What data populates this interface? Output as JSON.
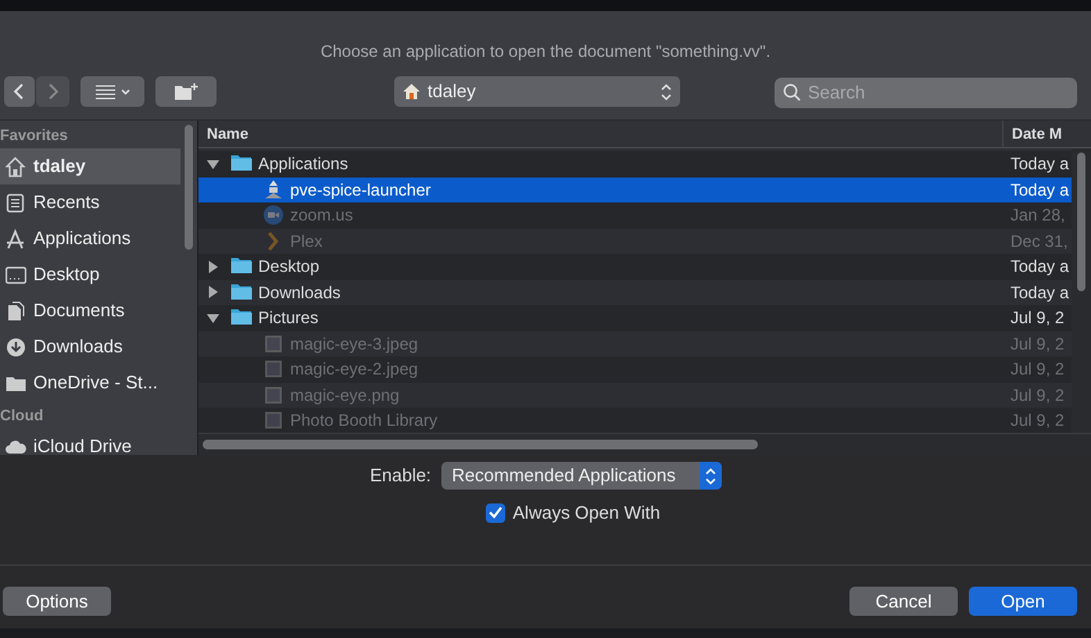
{
  "dialog": {
    "title": "Choose an application to open the document \"something.vv\"."
  },
  "toolbar": {
    "location": "tdaley",
    "search": {
      "placeholder": "Search"
    }
  },
  "sidebar": {
    "sections": [
      {
        "label": "Favorites",
        "items": [
          {
            "label": "tdaley",
            "kind": "home",
            "selected": true
          },
          {
            "label": "Recents",
            "kind": "recents",
            "selected": false
          },
          {
            "label": "Applications",
            "kind": "applications",
            "selected": false
          },
          {
            "label": "Desktop",
            "kind": "desktop",
            "selected": false
          },
          {
            "label": "Documents",
            "kind": "documents",
            "selected": false
          },
          {
            "label": "Downloads",
            "kind": "downloads",
            "selected": false
          },
          {
            "label": "OneDrive - St...",
            "kind": "folder",
            "selected": false
          }
        ]
      },
      {
        "label": "Cloud",
        "items": [
          {
            "label": "iCloud Drive",
            "kind": "cloud",
            "selected": false
          }
        ]
      }
    ]
  },
  "table": {
    "columns": [
      "Name",
      "Date M"
    ],
    "rows": [
      {
        "name": "Applications",
        "date": "Today a",
        "kind": "folder",
        "expanded": true,
        "enabled": true,
        "selected": false,
        "children": [
          {
            "name": "pve-spice-launcher",
            "date": "Today a",
            "kind": "app",
            "enabled": true,
            "selected": true
          },
          {
            "name": "zoom.us",
            "date": "Jan 28,",
            "kind": "video-app",
            "enabled": false,
            "selected": false
          },
          {
            "name": "Plex",
            "date": "Dec 31,",
            "kind": "chevron-app",
            "enabled": false,
            "selected": false
          }
        ]
      },
      {
        "name": "Desktop",
        "date": "Today a",
        "kind": "folder",
        "expanded": false,
        "enabled": true,
        "selected": false
      },
      {
        "name": "Downloads",
        "date": "Today a",
        "kind": "folder",
        "expanded": false,
        "enabled": true,
        "selected": false
      },
      {
        "name": "Pictures",
        "date": "Jul 9, 2",
        "kind": "folder",
        "expanded": true,
        "enabled": true,
        "selected": false,
        "children": [
          {
            "name": "magic-eye-3.jpeg",
            "date": "Jul 9, 2",
            "kind": "image",
            "enabled": false,
            "selected": false
          },
          {
            "name": "magic-eye-2.jpeg",
            "date": "Jul 9, 2",
            "kind": "image",
            "enabled": false,
            "selected": false
          },
          {
            "name": "magic-eye.png",
            "date": "Jul 9, 2",
            "kind": "image",
            "enabled": false,
            "selected": false
          },
          {
            "name": "Photo Booth Library",
            "date": "Jul 9, 2",
            "kind": "image",
            "enabled": false,
            "selected": false
          }
        ]
      }
    ]
  },
  "enable": {
    "label": "Enable:",
    "value": "Recommended Applications"
  },
  "always_open_with": {
    "label": "Always Open With",
    "checked": true
  },
  "buttons": [
    {
      "label": "Options",
      "kind": "secondary"
    },
    {
      "label": "Cancel",
      "kind": "secondary"
    },
    {
      "label": "Open",
      "kind": "primary"
    }
  ]
}
